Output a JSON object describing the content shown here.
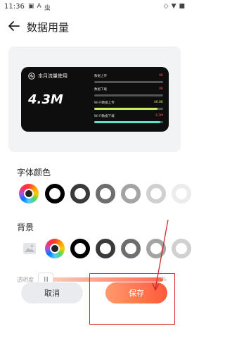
{
  "status": {
    "time": "11:36",
    "left_icons": [
      "▣",
      "A",
      "虫"
    ],
    "right_icons": [
      "◇",
      "▼",
      "■"
    ]
  },
  "header": {
    "title": "数据用量"
  },
  "widget": {
    "title": "本月流量使用",
    "total": "4.3M",
    "rows": [
      {
        "label": "数据上传",
        "value": "0K",
        "fill": 0.0,
        "color": "#ff5a4e",
        "value_color": "#ff5a4e"
      },
      {
        "label": "数据下载",
        "value": "0K",
        "fill": 0.0,
        "color": "#ff5a4e",
        "value_color": "#ff5a4e"
      },
      {
        "label": "Wi-Fi数据上传",
        "value": "46.8K",
        "fill": 0.92,
        "color": "#c8f05a",
        "value_color": "#c8f05a"
      },
      {
        "label": "Wi-Fi数据下载",
        "value": "4.2M",
        "fill": 0.96,
        "color": "#5ee0c8",
        "value_color": "#ff5a4e"
      }
    ]
  },
  "font_color": {
    "label": "字体颜色"
  },
  "background": {
    "label": "背景"
  },
  "opacity": {
    "label": "透明度",
    "end_text": "%",
    "value_fraction": 0.0
  },
  "actions": {
    "cancel_label": "取消",
    "save_label": "保存"
  },
  "colors": {
    "accent": "#ff6a4c",
    "annotation": "#d7262b"
  }
}
